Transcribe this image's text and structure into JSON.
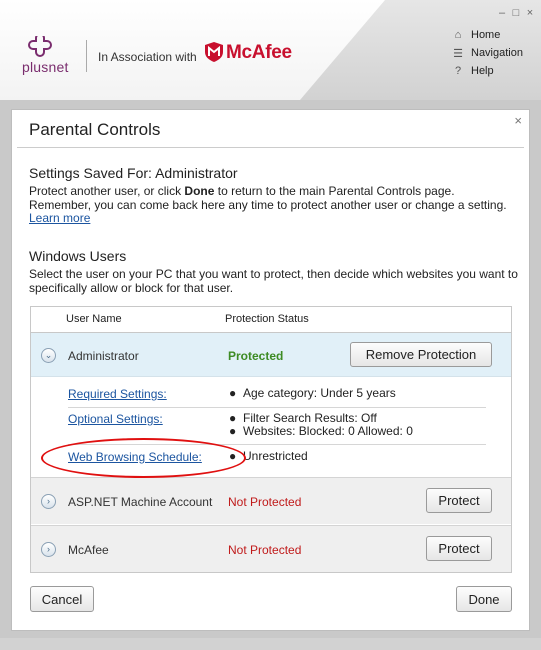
{
  "header": {
    "brand": "plusnet",
    "association": "In Association with",
    "partner": "McAfee",
    "window_controls": [
      "–",
      "□",
      "×"
    ],
    "nav": [
      {
        "label": "Home",
        "icon": "home-icon",
        "glyph": "⌂"
      },
      {
        "label": "Navigation",
        "icon": "navigation-icon",
        "glyph": "☰"
      },
      {
        "label": "Help",
        "icon": "help-icon",
        "glyph": "?"
      }
    ]
  },
  "panel": {
    "title": "Parental Controls",
    "close_glyph": "×",
    "settings": {
      "title": "Settings Saved For: Administrator",
      "text_before_done": "Protect another user, or click ",
      "done_word": "Done",
      "text_after_done": " to return to the main Parental Controls page. Remember, you can come back here any time to protect another user or change a setting. ",
      "learn_more": "Learn more"
    },
    "windows_users": {
      "title": "Windows Users",
      "text": "Select the user on your PC that you want to protect, then decide which websites you want to specifically allow or block for that user."
    },
    "table": {
      "headers": {
        "user": "User Name",
        "status": "Protection Status"
      },
      "admin": {
        "name": "Administrator",
        "status": "Protected",
        "button": "Remove Protection",
        "expand_glyph": "⌄"
      },
      "details": {
        "required_label": "Required Settings:",
        "required_value": "Age category: Under 5 years",
        "optional_label": "Optional Settings:",
        "optional_value_1": "Filter Search Results: Off",
        "optional_value_2": "Websites: Blocked: 0 Allowed: 0",
        "schedule_label": "Web Browsing Schedule:",
        "schedule_value": "Unrestricted",
        "bullet": "●"
      },
      "other_users": [
        {
          "name": "ASP.NET Machine Account",
          "status": "Not Protected",
          "button": "Protect",
          "expand_glyph": "›"
        },
        {
          "name": "McAfee",
          "status": "Not Protected",
          "button": "Protect",
          "expand_glyph": "›"
        }
      ]
    },
    "buttons": {
      "cancel": "Cancel",
      "done": "Done"
    }
  },
  "colors": {
    "brand_purple": "#7a2d6e",
    "mcafee_red": "#c8102e",
    "protected_green": "#3d8b24",
    "not_protected_red": "#c01a1a",
    "link_blue": "#1c55a0",
    "highlight_oval": "#e01010"
  }
}
